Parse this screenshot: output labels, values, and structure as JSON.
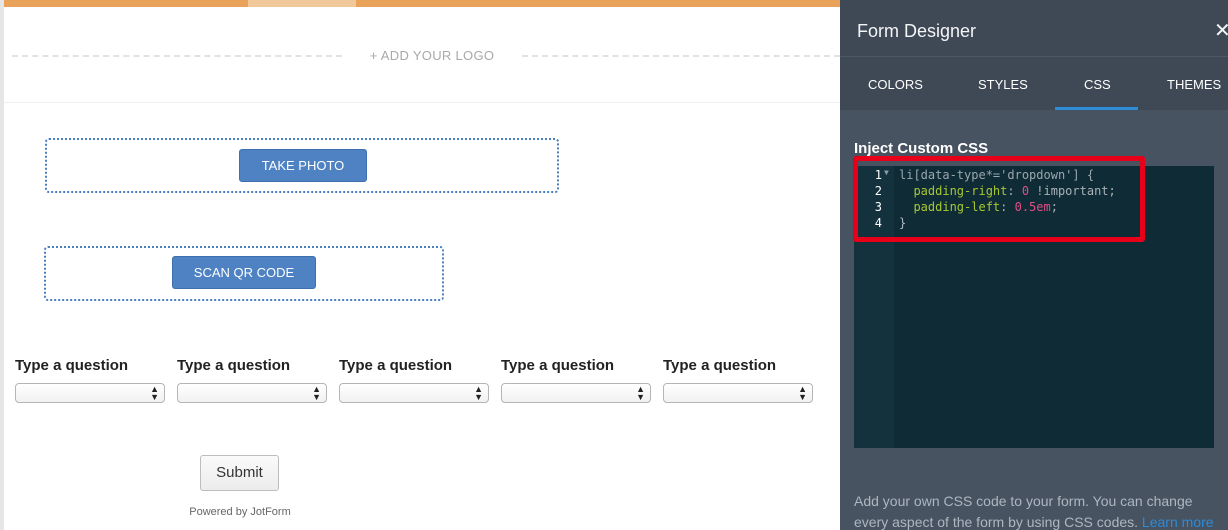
{
  "form": {
    "logo_placeholder": "+ ADD YOUR LOGO",
    "take_photo_label": "TAKE PHOTO",
    "scan_qr_label": "SCAN QR CODE",
    "questions": [
      {
        "label": "Type a question",
        "value": ""
      },
      {
        "label": "Type a question",
        "value": ""
      },
      {
        "label": "Type a question",
        "value": ""
      },
      {
        "label": "Type a question",
        "value": ""
      },
      {
        "label": "Type a question",
        "value": ""
      }
    ],
    "submit_label": "Submit",
    "powered_by": "Powered by JotForm"
  },
  "designer": {
    "title": "Form Designer",
    "close_icon": "close-icon",
    "tabs": [
      {
        "label": "COLORS",
        "active": false
      },
      {
        "label": "STYLES",
        "active": false
      },
      {
        "label": "CSS",
        "active": true
      },
      {
        "label": "THEMES",
        "active": false
      }
    ],
    "section_title": "Inject Custom CSS",
    "code": {
      "line_numbers": [
        "1",
        "2",
        "3",
        "4"
      ],
      "line1": "li[data-type*='dropdown'] {",
      "line2_prop": "padding-right",
      "line2_sep": ": ",
      "line2_value": "0",
      "line2_rest": " !important;",
      "line3_prop": "padding-left",
      "line3_sep": ": ",
      "line3_value": "0.5em",
      "line3_rest": ";",
      "line4": "}"
    },
    "help_text": "Add your own CSS code to your form. You can change every aspect of the form by using CSS codes.",
    "help_link": "Learn more"
  },
  "colors": {
    "accent": "#e9a25a",
    "button_blue": "#4e82c3",
    "panel_bg": "#475361",
    "editor_bg": "#0f2b36",
    "tab_active": "#2e8bd6",
    "highlight": "#e8001a"
  }
}
